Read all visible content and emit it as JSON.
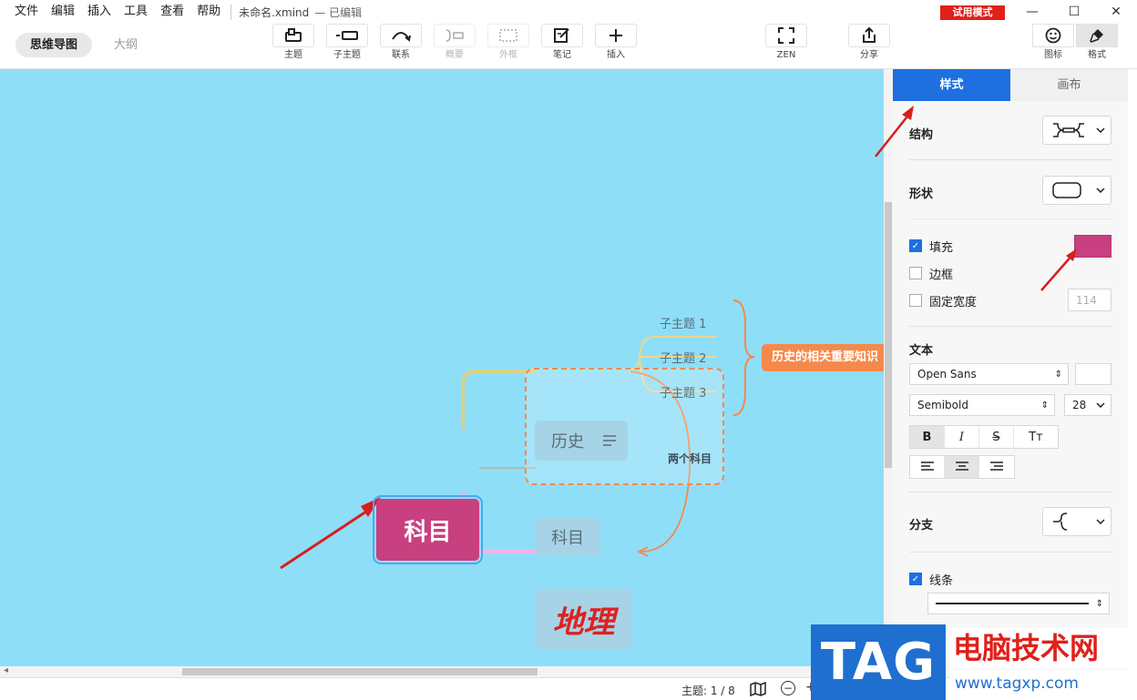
{
  "menu": {
    "items": [
      "文件",
      "编辑",
      "插入",
      "工具",
      "查看",
      "帮助"
    ],
    "doc_title": "未命名.xmind",
    "doc_status": "— 已编辑",
    "trial_badge": "试用模式"
  },
  "window": {
    "minimize": "—",
    "maximize": "☐",
    "close": "✕"
  },
  "toolbar": {
    "modes": [
      "思维导图",
      "大纲"
    ],
    "tools": [
      {
        "label": "主题",
        "icon": "topic-icon"
      },
      {
        "label": "子主题",
        "icon": "subtopic-icon"
      },
      {
        "label": "联系",
        "icon": "relationship-icon"
      },
      {
        "label": "概要",
        "icon": "summary-icon"
      },
      {
        "label": "外框",
        "icon": "boundary-icon"
      },
      {
        "label": "笔记",
        "icon": "note-icon"
      },
      {
        "label": "插入",
        "icon": "plus-icon"
      },
      {
        "label": "ZEN",
        "icon": "fullscreen-icon"
      },
      {
        "label": "分享",
        "icon": "share-icon"
      }
    ],
    "right_tools": [
      {
        "label": "图标",
        "icon": "smiley-icon"
      },
      {
        "label": "格式",
        "icon": "format-brush-icon"
      }
    ]
  },
  "mindmap": {
    "central": "科目",
    "topics": [
      "历史",
      "科目",
      "地理"
    ],
    "subtopics": [
      "子主题 1",
      "子主题 2",
      "子主题 3"
    ],
    "summary": "历史的相关重要知识",
    "relationship": "两个科目"
  },
  "statusbar": {
    "topic_count": "主题: 1 / 8",
    "zoom_out": "−",
    "zoom_in": "+"
  },
  "panel": {
    "tabs": [
      "样式",
      "画布"
    ],
    "structure_label": "结构",
    "shape_label": "形状",
    "fill_label": "填充",
    "border_label": "边框",
    "fixed_width_label": "固定宽度",
    "fixed_width_value": "114",
    "fill_color": "#c8407f",
    "text_label": "文本",
    "font_family": "Open Sans",
    "font_weight": "Semibold",
    "font_size": "28",
    "bold": "B",
    "italic": "I",
    "strike": "S",
    "case": "Tт",
    "branch_label": "分支",
    "line_label": "线条",
    "fill_checked": true,
    "border_checked": false,
    "fixed_width_checked": false,
    "line_checked": true
  },
  "watermark": {
    "logo": "TAG",
    "title": "电脑技术网",
    "url": "www.tagxp.com"
  },
  "colors": {
    "canvas": "#8fdef8",
    "central": "#c8407f",
    "accent": "#1e6fe0",
    "orange": "#f5894b",
    "trial": "#e0201a"
  }
}
